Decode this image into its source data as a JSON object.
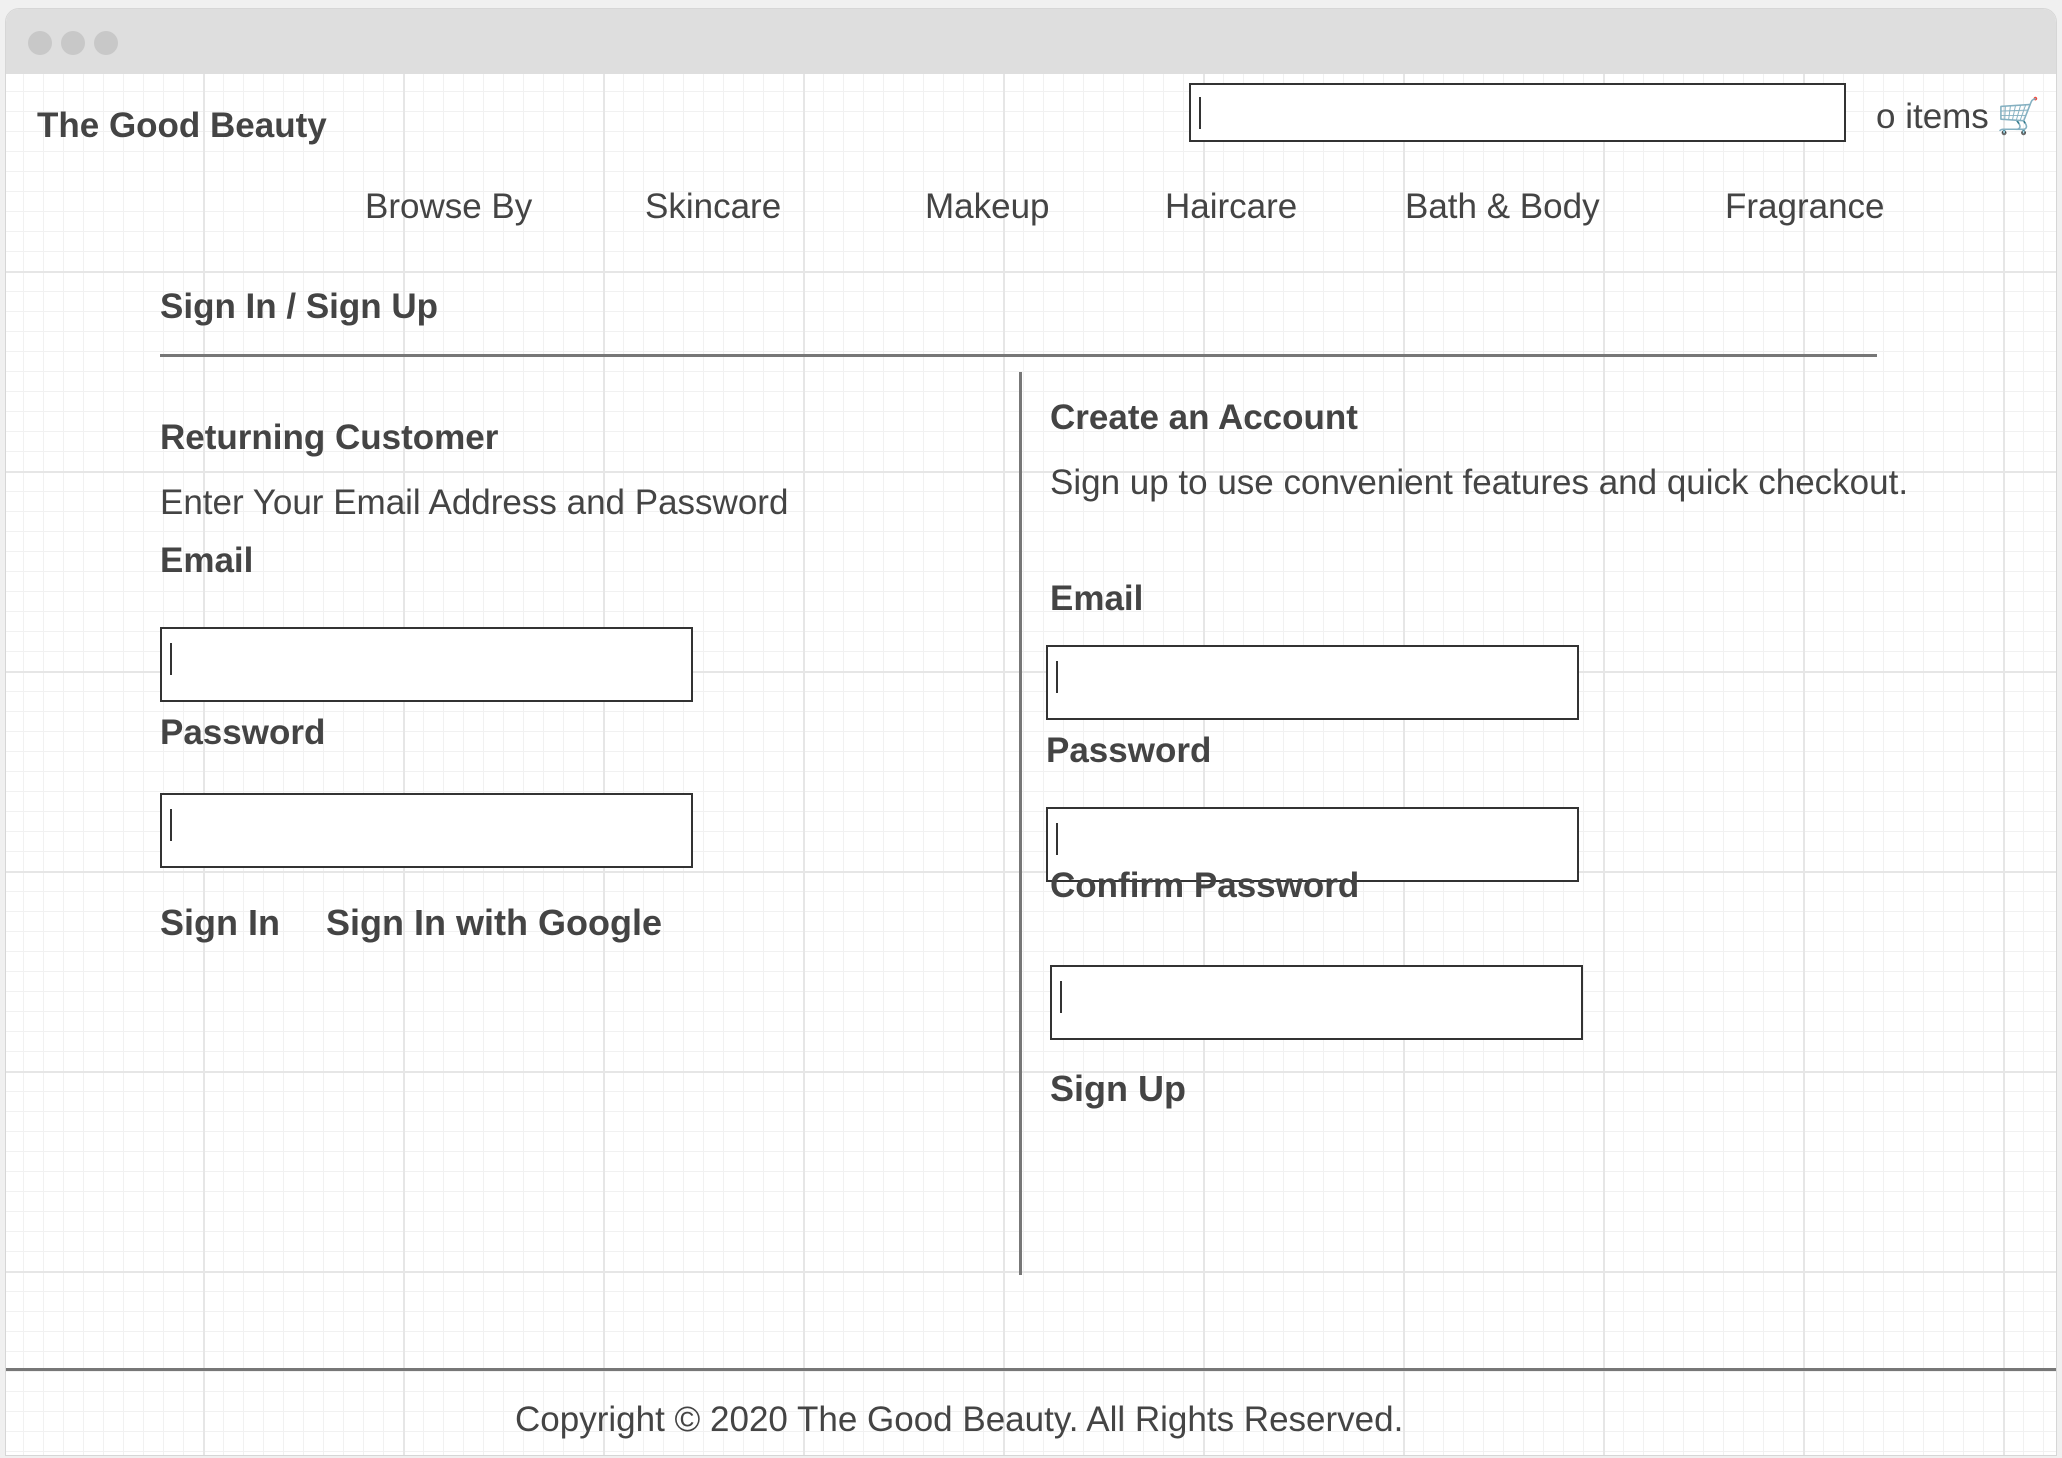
{
  "header": {
    "logo": "The Good Beauty",
    "search": {
      "value": "",
      "placeholder": ""
    },
    "cart_text": "o items",
    "cart_icon": "shopping-cart-icon"
  },
  "nav": {
    "items": [
      "Browse By",
      "Skincare",
      "Makeup",
      "Haircare",
      "Bath & Body",
      "Fragrance"
    ]
  },
  "page": {
    "title": "Sign In / Sign Up"
  },
  "returning": {
    "heading": "Returning Customer",
    "description": "Enter Your Email Address and Password",
    "email_label": "Email",
    "password_label": "Password",
    "signin_label": "Sign In",
    "google_label": "Sign In with Google"
  },
  "create": {
    "heading": "Create an Account",
    "description": "Sign up to use convenient features and quick checkout.",
    "email_label": "Email",
    "password_label": "Password",
    "confirm_label": "Confirm Password",
    "signup_label": "Sign Up"
  },
  "footer": {
    "copyright": "Copyright © 2020 The Good Beauty. All Rights Reserved."
  }
}
